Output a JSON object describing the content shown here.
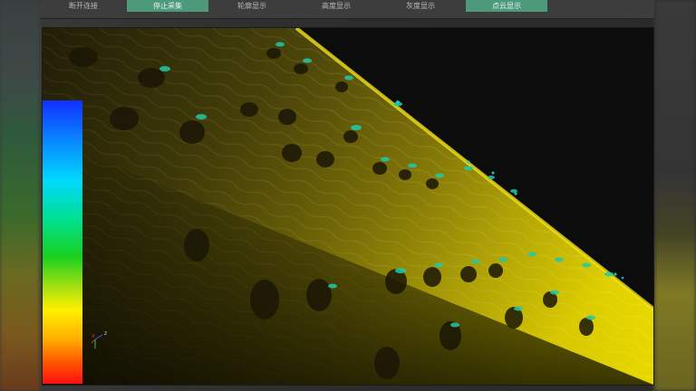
{
  "toolbar": {
    "buttons": [
      {
        "label": "断开连接",
        "active": false
      },
      {
        "label": "停止采集",
        "active": true
      },
      {
        "label": "轮廓显示",
        "active": false
      },
      {
        "label": "高度显示",
        "active": false
      },
      {
        "label": "灰度显示",
        "active": false
      },
      {
        "label": "点云显示",
        "active": true
      }
    ]
  },
  "viewport": {
    "axis_labels": {
      "x": "x",
      "z": "z"
    }
  },
  "colors": {
    "active_button": "#4d9a7a",
    "cloud_high": "#e8d800",
    "cloud_edge": "#20c0a0",
    "background": "#0c0c0c"
  }
}
